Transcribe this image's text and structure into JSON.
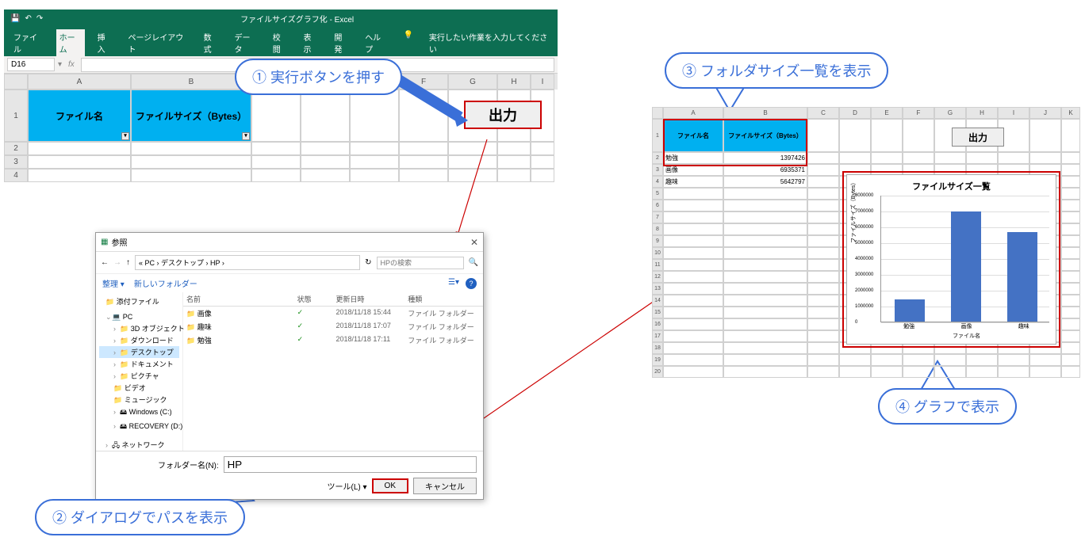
{
  "app": {
    "title": "ファイルサイズグラフ化  -  Excel"
  },
  "ribbon": {
    "tabs": [
      "ファイル",
      "ホーム",
      "挿入",
      "ページレイアウト",
      "数式",
      "データ",
      "校閲",
      "表示",
      "開発",
      "ヘルプ"
    ],
    "tell_me": "実行したい作業を入力してください"
  },
  "formula_bar": {
    "name_box": "D16",
    "fx": "fx"
  },
  "sheet1": {
    "cols": [
      "A",
      "B",
      "C",
      "D",
      "E",
      "F",
      "G",
      "H",
      "I"
    ],
    "header_a": "ファイル名",
    "header_b": "ファイルサイズ（Bytes）",
    "output_btn": "出力"
  },
  "callouts": {
    "c1": "① 実行ボタンを押す",
    "c2": "② ダイアログでパスを表示",
    "c3": "③ フォルダサイズ一覧を表示",
    "c4": "④ グラフで表示"
  },
  "dialog": {
    "title": "参照",
    "nav": {
      "back": "←",
      "fwd": "→",
      "up": "↑"
    },
    "breadcrumb": "« PC › デスクトップ › HP ›",
    "refresh": "↻",
    "search_placeholder": "HPの検索",
    "organize": "整理 ▾",
    "new_folder": "新しいフォルダー",
    "tree": {
      "attach": "添付ファイル",
      "pc": "PC",
      "nodes": [
        "3D オブジェクト",
        "ダウンロード",
        "デスクトップ",
        "ドキュメント",
        "ピクチャ",
        "ビデオ",
        "ミュージック",
        "Windows (C:)",
        "RECOVERY (D:)"
      ],
      "network": "ネットワーク"
    },
    "list": {
      "hdr": [
        "名前",
        "状態",
        "更新日時",
        "種類"
      ],
      "rows": [
        {
          "name": "画像",
          "status": "✓",
          "date": "2018/11/18 15:44",
          "type": "ファイル フォルダー"
        },
        {
          "name": "趣味",
          "status": "✓",
          "date": "2018/11/18 17:07",
          "type": "ファイル フォルダー"
        },
        {
          "name": "勉強",
          "status": "✓",
          "date": "2018/11/18 17:11",
          "type": "ファイル フォルダー"
        }
      ]
    },
    "folder_label": "フォルダー名(N):",
    "folder_value": "HP",
    "tools": "ツール(L) ▾",
    "ok": "OK",
    "cancel": "キャンセル"
  },
  "sheet2": {
    "cols": [
      "A",
      "B",
      "C",
      "D",
      "E",
      "F",
      "G",
      "H",
      "I",
      "J",
      "K"
    ],
    "header_a": "ファイル名",
    "header_b": "ファイルサイズ（Bytes）",
    "output_btn": "出力",
    "rows": [
      {
        "name": "勉強",
        "size": "1397426"
      },
      {
        "name": "画像",
        "size": "6935371"
      },
      {
        "name": "趣味",
        "size": "5642797"
      }
    ]
  },
  "chart_data": {
    "type": "bar",
    "title": "ファイルサイズ一覧",
    "categories": [
      "勉強",
      "画像",
      "趣味"
    ],
    "values": [
      1397426,
      6935371,
      5642797
    ],
    "xlabel": "ファイル名",
    "ylabel": "ファイルサイズ（Bytes）",
    "ylim": [
      0,
      8000000
    ],
    "yticks": [
      0,
      1000000,
      2000000,
      3000000,
      4000000,
      5000000,
      6000000,
      7000000,
      8000000
    ]
  }
}
